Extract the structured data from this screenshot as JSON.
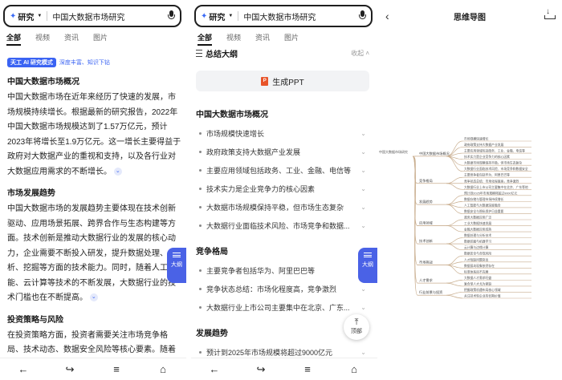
{
  "search": {
    "mode": "研究",
    "query": "中国大数据市场研究"
  },
  "tabs": [
    "全部",
    "视频",
    "资讯",
    "图片"
  ],
  "ai_badge": {
    "label": "天工 AI 研究模式",
    "desc": "深度丰富、知识下钻"
  },
  "article": {
    "h1": "中国大数据市场概况",
    "p1": "中国大数据市场在近年来经历了快速的发展，市场规模持续增长。根据最新的研究报告，2022年中国大数据市场规模达到了1.57万亿元，预计2023年将增长至1.9万亿元。这一增长主要得益于政府对大数据产业的重视和支持，以及各行业对大数据应用需求的不断增长。",
    "h2": "市场发展趋势",
    "p2": "中国大数据市场的发展趋势主要体现在技术创新驱动、应用场景拓展、跨界合作与生态构建等方面。技术创新是推动大数据行业的发展的核心动力，企业需要不断投入研发，提升数据处理、分析、挖掘等方面的技术能力。同时，随着人工智能、云计算等技术的不断发展，大数据行业的技术门槛也在不断提高。",
    "h3": "投资策略与风险",
    "p3": "在投资策略方面，投资者需要关注市场竞争格局、技术动态、数据安全风险等核心要素。随着市场竞争的加剧和市场集中度的提高，新进入者"
  },
  "float_toc_label": "大纲",
  "top_button_label": "顶部",
  "summary": {
    "title": "总结大纲",
    "collapse": "收起",
    "ppt_label": "生成PPT",
    "sections": [
      {
        "title": "中国大数据市场概况",
        "items": [
          "市场规模快速增长",
          "政府政策支持大数据产业发展",
          "主要应用领域包括政务、工业、金融、电信等",
          "技术实力是企业竞争力的核心因素",
          "大数据市场规模保持平稳，但市场生态复杂",
          "大数据行业面临技术风险、市场竞争和数据..."
        ]
      },
      {
        "title": "竞争格局",
        "items": [
          "主要竞争者包括华为、阿里巴巴等",
          "竞争状态总结：市场化程度高，竞争激烈",
          "大数据行业上市公司主要集中在北京、广东..."
        ]
      },
      {
        "title": "发展趋势",
        "items": [
          "预计到2025年市场规模将超过9000亿元"
        ]
      }
    ]
  },
  "mindmap": {
    "title": "思维导图",
    "root": "中国大数据市场研究",
    "branches": [
      {
        "label": "中国大数据市场概况",
        "leaves": [
          "市场规模快速增长",
          "政府政策支持大数据产业发展",
          "主要应用领域包括政务、工业、金融、电信等",
          "技术实力是企业竞争力的核心因素",
          "大数据市场规模保持平稳，但市场生态复杂",
          "大数据行业面临技术风险、市场竞争和数据安全"
        ]
      },
      {
        "label": "竞争格局",
        "leaves": [
          "主要竞争者包括华为、阿里巴巴等",
          "竞争状态总结：市场化程度高，竞争激烈",
          "大数据行业上市公司主要集中在北京、广东等地"
        ]
      },
      {
        "label": "发展趋势",
        "leaves": [
          "预计到2025年市场规模将超过9000亿元",
          "数据存储与管理市场持续增长",
          "人工智能与大数据深度融合",
          "数据安全与隐私保护日益重要"
        ]
      },
      {
        "label": "应用领域",
        "leaves": [
          "政务大数据应用广泛",
          "工业大数据快速发展",
          "金融大数据应用成熟"
        ]
      },
      {
        "label": "技术创新",
        "leaves": [
          "数据处理与分析技术",
          "数据挖掘与机器学习",
          "云计算与边缘计算"
        ]
      },
      {
        "label": "市场挑战",
        "leaves": [
          "数据安全与合规风险",
          "人才短缺问题突出",
          "数据孤岛现象依然存在",
          "标准体系尚不完善"
        ]
      },
      {
        "label": "人才需求",
        "leaves": [
          "大数据人才需求旺盛",
          "复合型人才尤为紧缺"
        ]
      },
      {
        "label": "行业前景与投资",
        "leaves": [
          "把握政策机遇布局核心领域",
          "关注技术型企业的长期价值"
        ]
      }
    ]
  }
}
